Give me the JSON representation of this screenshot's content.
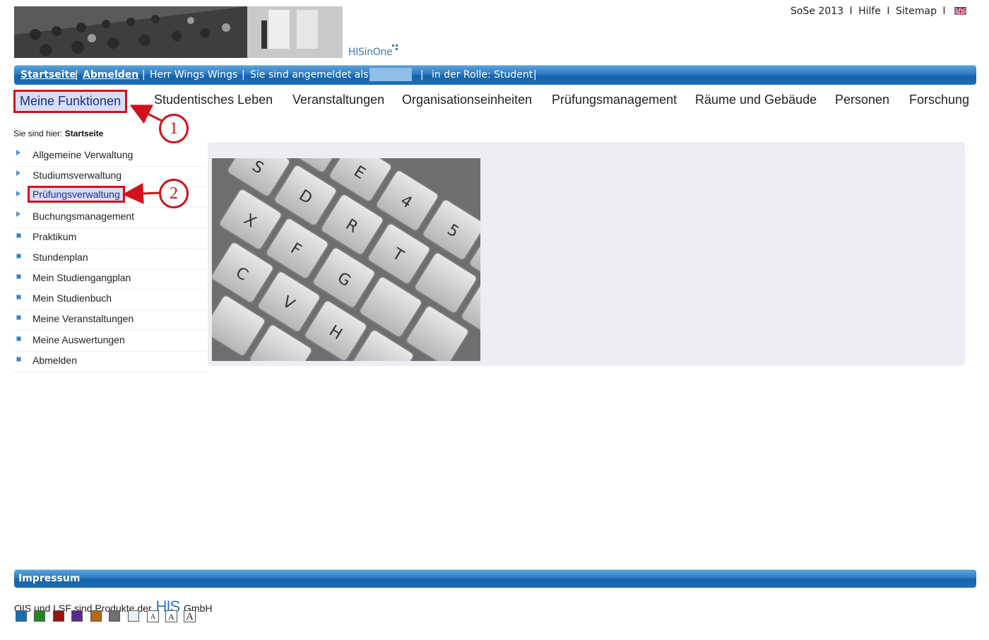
{
  "header": {
    "logo_text": "HISinOne",
    "semester": "SoSe 2013",
    "help": "Hilfe",
    "sitemap": "Sitemap",
    "separator": "I",
    "flag_icon": "uk-flag-icon"
  },
  "userbar": {
    "home": "Startseite",
    "logout": "Abmelden",
    "user": "Herr Wings Wings",
    "logged_in_as": "Sie sind angemeldet als:",
    "role": "in der Rolle: Student"
  },
  "nav": [
    {
      "label": "Meine Funktionen"
    },
    {
      "label": "Studentisches Leben"
    },
    {
      "label": "Veranstaltungen"
    },
    {
      "label": "Organisationseinheiten"
    },
    {
      "label": "Prüfungsmanagement"
    },
    {
      "label": "Räume und Gebäude"
    },
    {
      "label": "Personen"
    },
    {
      "label": "Forschung"
    }
  ],
  "breadcrumb": {
    "prefix": "Sie sind hier:",
    "current": "Startseite"
  },
  "menu": [
    {
      "label": "Allgemeine Verwaltung",
      "icon": "expand-triangle-icon"
    },
    {
      "label": "Studiumsverwaltung",
      "icon": "expand-triangle-icon"
    },
    {
      "label": "Prüfungsverwaltung",
      "icon": "expand-triangle-icon"
    },
    {
      "label": "Buchungsmanagement",
      "icon": "expand-triangle-icon"
    },
    {
      "label": "Praktikum",
      "icon": "bullet-square-icon"
    },
    {
      "label": "Stundenplan",
      "icon": "bullet-square-icon"
    },
    {
      "label": "Mein Studiengangplan",
      "icon": "bullet-square-icon"
    },
    {
      "label": "Mein Studienbuch",
      "icon": "bullet-square-icon"
    },
    {
      "label": "Meine Veranstaltungen",
      "icon": "bullet-square-icon"
    },
    {
      "label": "Meine Auswertungen",
      "icon": "bullet-square-icon"
    },
    {
      "label": "Abmelden",
      "icon": "bullet-square-icon"
    }
  ],
  "annotations": {
    "one": "1",
    "two": "2"
  },
  "footer": {
    "impressum": "Impressum",
    "product_prefix": "QIS und LSF sind Produkte der",
    "his": "HIS",
    "product_suffix": "GmbH",
    "font_button": "A"
  },
  "colors": {
    "accent_blue": "#1b6fb7",
    "annotation_red": "#d0121a",
    "highlight_bg": "#d9dcf5",
    "swatches": [
      "#1a6fb3",
      "#1e8a1e",
      "#9b1111",
      "#5a2a8c",
      "#b56a10",
      "#707070",
      "#e8f0fa"
    ]
  }
}
